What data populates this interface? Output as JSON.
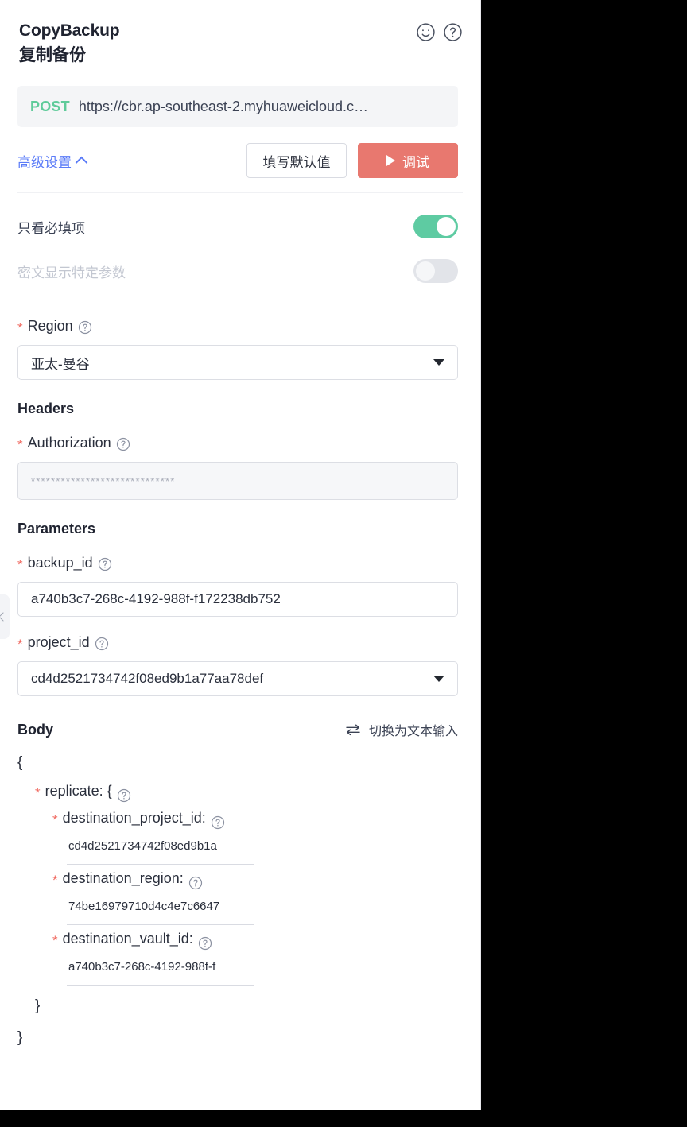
{
  "header": {
    "title_en": "CopyBackup",
    "title_cn": "复制备份",
    "smiley_icon": "smiley-icon",
    "help_icon": "question-circle-icon"
  },
  "request": {
    "method": "POST",
    "url": "https://cbr.ap-southeast-2.myhuaweicloud.c…"
  },
  "toolbar": {
    "advanced_settings": "高级设置",
    "fill_defaults": "填写默认值",
    "debug": "调试"
  },
  "toggles": [
    {
      "label": "只看必填项",
      "state": "on",
      "disabled": false
    },
    {
      "label": "密文显示特定参数",
      "state": "off",
      "disabled": true
    }
  ],
  "region": {
    "label": "Region",
    "required": "*",
    "value": "亚太-曼谷"
  },
  "headers_section": {
    "title": "Headers",
    "authorization": {
      "label": "Authorization",
      "required": "*",
      "value": "*****************************"
    }
  },
  "parameters_section": {
    "title": "Parameters",
    "fields": [
      {
        "label": "backup_id",
        "required": "*",
        "value": "a740b3c7-268c-4192-988f-f172238db752",
        "type": "text"
      },
      {
        "label": "project_id",
        "required": "*",
        "value": "cd4d2521734742f08ed9b1a77aa78def",
        "type": "select"
      }
    ]
  },
  "body_section": {
    "title": "Body",
    "switch_to_text": "切换为文本输入",
    "open_brace": "{",
    "close_brace": "}",
    "replicate": {
      "label": "replicate: {",
      "required": "*",
      "close": "}",
      "fields": [
        {
          "label": "destination_project_id:",
          "required": "*",
          "value": "cd4d2521734742f08ed9b1a"
        },
        {
          "label": "destination_region:",
          "required": "*",
          "value": "74be16979710d4c4e7c6647"
        },
        {
          "label": "destination_vault_id:",
          "required": "*",
          "value": "a740b3c7-268c-4192-988f-f"
        }
      ]
    }
  },
  "colors": {
    "method_green": "#5fcb9a",
    "primary_red": "#e8786f",
    "link_blue": "#5b7cf8",
    "required_star": "#f06a61",
    "toggle_on": "#5ecba2"
  }
}
